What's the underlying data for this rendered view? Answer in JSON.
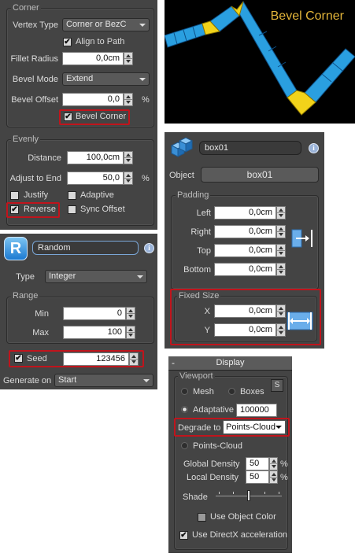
{
  "corner_panel": {
    "corner_title": "Corner",
    "vertex_type_label": "Vertex Type",
    "vertex_type_value": "Corner or BezC",
    "align_to_path_label": "Align to Path",
    "fillet_radius_label": "Fillet Radius",
    "fillet_radius_value": "0,0cm",
    "bevel_mode_label": "Bevel Mode",
    "bevel_mode_value": "Extend",
    "bevel_offset_label": "Bevel Offset",
    "bevel_offset_value": "0,0",
    "bevel_offset_unit": "%",
    "bevel_corner_label": "Bevel Corner",
    "evenly_title": "Evenly",
    "distance_label": "Distance",
    "distance_value": "100,0cm",
    "adjust_label": "Adjust to End",
    "adjust_value": "50,0",
    "adjust_unit": "%",
    "justify_label": "Justify",
    "adaptive_label": "Adaptive",
    "reverse_label": "Reverse",
    "sync_offset_label": "Sync Offset"
  },
  "viewport_preview": {
    "title": "Bevel Corner",
    "path_color": "#2a9fe0",
    "corner_color": "#f2d31a",
    "bg_color": "#000000"
  },
  "random_panel": {
    "name": "Random",
    "type_label": "Type",
    "type_value": "Integer",
    "range_title": "Range",
    "min_label": "Min",
    "min_value": "0",
    "max_label": "Max",
    "max_value": "100",
    "seed_label": "Seed",
    "seed_value": "123456",
    "generate_label": "Generate on",
    "generate_value": "Start"
  },
  "box_panel": {
    "name": "box01",
    "object_label": "Object",
    "object_value": "box01",
    "padding_title": "Padding",
    "left_label": "Left",
    "left_value": "0,0cm",
    "right_label": "Right",
    "right_value": "0,0cm",
    "top_label": "Top",
    "top_value": "0,0cm",
    "bottom_label": "Bottom",
    "bottom_value": "0,0cm",
    "fixed_size_title": "Fixed Size",
    "x_label": "X",
    "x_value": "0,0cm",
    "y_label": "Y",
    "y_value": "0,0cm"
  },
  "display_panel": {
    "collapse_sign": "-",
    "title": "Display",
    "viewport_title": "Viewport",
    "mesh_label": "Mesh",
    "boxes_label": "Boxes",
    "s_button": "S",
    "adaptative_label": "Adaptative",
    "adaptative_value": "100000",
    "degrade_label": "Degrade to",
    "degrade_value": "Points-Cloud",
    "points_cloud_label": "Points-Cloud",
    "global_density_label": "Global Density",
    "global_density_value": "50",
    "global_density_unit": "%",
    "local_density_label": "Local Density",
    "local_density_value": "50",
    "local_density_unit": "%",
    "shade_label": "Shade",
    "use_object_color_label": "Use Object Color",
    "use_directx_label": "Use DirectX acceleration"
  },
  "icons": {
    "check": "✔",
    "info": "i",
    "r_logo": "R"
  }
}
